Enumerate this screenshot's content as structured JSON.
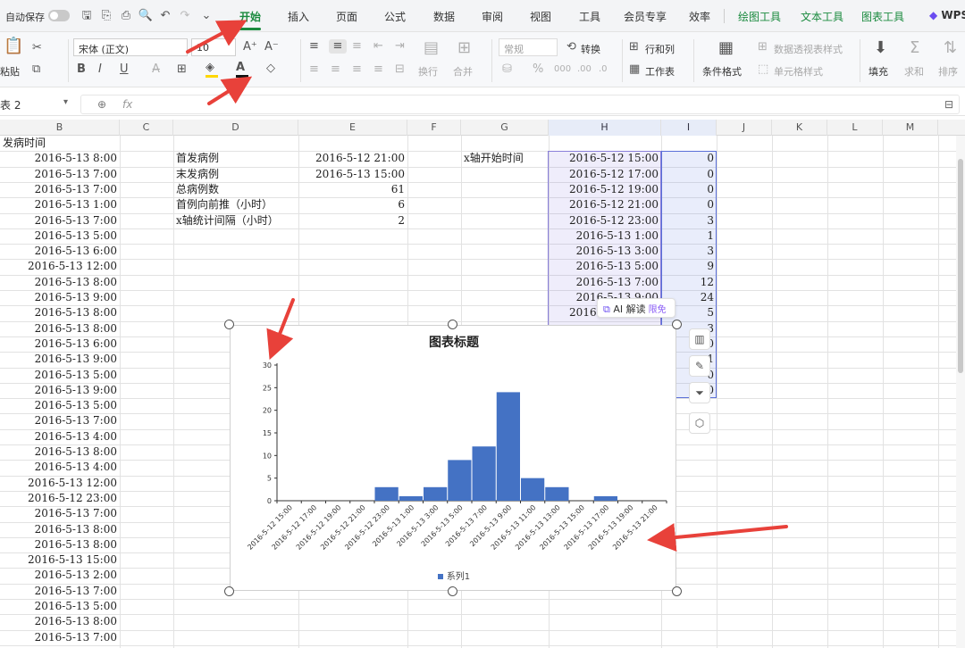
{
  "titlebar": {
    "autosave_label": "自动保存",
    "tabs": [
      "开始",
      "插入",
      "页面",
      "公式",
      "数据",
      "审阅",
      "视图",
      "工具",
      "会员专享",
      "效率"
    ],
    "context_tabs": [
      "绘图工具",
      "文本工具",
      "图表工具"
    ],
    "wps_label": "WPS"
  },
  "ribbon": {
    "paste_label": "粘贴",
    "font_name": "宋体 (正文)",
    "font_size": "10",
    "number_format": "常规",
    "convert_label": "转换",
    "rows_cols_label": "行和列",
    "worksheet_label": "工作表",
    "cond_format_label": "条件格式",
    "pivot_style_label": "数据透视表样式",
    "cell_style_label": "单元格样式",
    "fill_label": "填充",
    "sum_label": "求和",
    "sort_label": "排序",
    "wrap_label": "换行",
    "merge_label": "合并",
    "font_color_accent": "#d81b1b",
    "highlight_color": "#ffd700"
  },
  "formulabar": {
    "name_box": "表 2",
    "fx_label": "fx"
  },
  "columns": [
    "B",
    "C",
    "D",
    "E",
    "F",
    "G",
    "H",
    "I",
    "J",
    "K",
    "L",
    "M"
  ],
  "sheet": {
    "colB_header": "发病时间",
    "colB": [
      "2016-5-13 8:00",
      "2016-5-13 7:00",
      "2016-5-13 7:00",
      "2016-5-13 1:00",
      "2016-5-13 7:00",
      "2016-5-13 5:00",
      "2016-5-13 6:00",
      "2016-5-13 12:00",
      "2016-5-13 8:00",
      "2016-5-13 9:00",
      "2016-5-13 8:00",
      "2016-5-13 8:00",
      "2016-5-13 6:00",
      "2016-5-13 9:00",
      "2016-5-13 5:00",
      "2016-5-13 9:00",
      "2016-5-13 5:00",
      "2016-5-13 7:00",
      "2016-5-13 4:00",
      "2016-5-13 8:00",
      "2016-5-13 4:00",
      "2016-5-13 12:00",
      "2016-5-12 23:00",
      "2016-5-13 7:00",
      "2016-5-13 8:00",
      "2016-5-13 8:00",
      "2016-5-13 15:00",
      "2016-5-13 2:00",
      "2016-5-13 7:00",
      "2016-5-13 5:00",
      "2016-5-13 8:00",
      "2016-5-13 7:00"
    ],
    "stats": [
      {
        "label": "首发病例",
        "value": "2016-5-12 21:00"
      },
      {
        "label": "末发病例",
        "value": "2016-5-13 15:00"
      },
      {
        "label": "总病例数",
        "value": "61"
      },
      {
        "label": "首例向前推（小时）",
        "value": "6"
      },
      {
        "label": "x轴统计间隔（小时）",
        "value": "2"
      }
    ],
    "g_label": "x轴开始时间",
    "h_visible": [
      "2016-5-12 15:00",
      "2016-5-12 17:00",
      "2016-5-12 19:00",
      "2016-5-12 21:00",
      "2016-5-12 23:00",
      "2016-5-13 1:00",
      "2016-5-13 3:00",
      "2016-5-13 5:00",
      "2016-5-13 7:00",
      "2016-5-13 9:00",
      "2016-5-13 11:00"
    ],
    "i_visible": [
      "0",
      "0",
      "0",
      "0",
      "3",
      "1",
      "3",
      "9",
      "12",
      "24",
      "5",
      "3",
      "0",
      "1",
      "0",
      "0"
    ]
  },
  "ai_pill": {
    "label": "AI 解读",
    "tag": "限免"
  },
  "chart_data": {
    "type": "bar",
    "title": "图表标题",
    "categories": [
      "2016-5-12 15:00",
      "2016-5-12 17:00",
      "2016-5-12 19:00",
      "2016-5-12 21:00",
      "2016-5-12 23:00",
      "2016-5-13 1:00",
      "2016-5-13 3:00",
      "2016-5-13 5:00",
      "2016-5-13 7:00",
      "2016-5-13 9:00",
      "2016-5-13 11:00",
      "2016-5-13 13:00",
      "2016-5-13 15:00",
      "2016-5-13 17:00",
      "2016-5-13 19:00",
      "2016-5-13 21:00"
    ],
    "series": [
      {
        "name": "系列1",
        "values": [
          0,
          0,
          0,
          0,
          3,
          1,
          3,
          9,
          12,
          24,
          5,
          3,
          0,
          1,
          0,
          0
        ],
        "color": "#4472c4"
      }
    ],
    "ylim": [
      0,
      30
    ],
    "yticks": [
      0,
      5,
      10,
      15,
      20,
      25,
      30
    ],
    "legend_position": "bottom",
    "grid": false
  }
}
